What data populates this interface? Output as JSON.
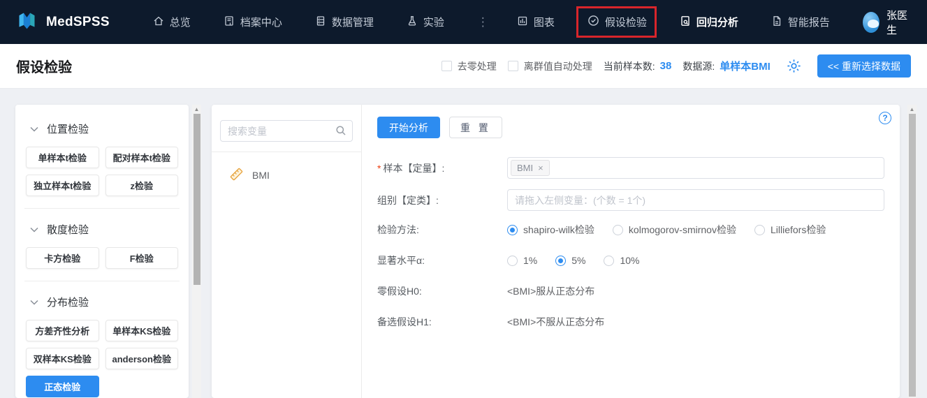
{
  "colors": {
    "nav_bg": "#0d1a2c",
    "accent_blue": "#2d8cf0",
    "annotation_red": "#d8252b",
    "variable_icon_orange": "#e6a23c",
    "page_bg": "#eef0f4"
  },
  "nav": {
    "brand": "MedSPSS",
    "items": [
      {
        "label": "总览",
        "icon": "home-icon"
      },
      {
        "label": "档案中心",
        "icon": "archive-icon"
      },
      {
        "label": "数据管理",
        "icon": "database-icon"
      },
      {
        "label": "实验",
        "icon": "flask-icon"
      },
      {
        "label": "图表",
        "icon": "chart-icon"
      },
      {
        "label": "假设检验",
        "icon": "check-circle-icon",
        "annotated": true
      },
      {
        "label": "回归分析",
        "icon": "doc-search-icon",
        "emphasized": true
      },
      {
        "label": "智能报告",
        "icon": "report-icon"
      }
    ],
    "more_dots": "⋮",
    "user_name": "张医生"
  },
  "header": {
    "title": "假设检验",
    "zero_checkbox_label": "去零处理",
    "outlier_checkbox_label": "离群值自动处理",
    "sample_count_label": "当前样本数:",
    "sample_count": "38",
    "datasource_label": "数据源:",
    "datasource_value": "单样本BMI",
    "reselect_button": "<< 重新选择数据"
  },
  "sidebar": {
    "sections": [
      {
        "title": "位置检验",
        "items": [
          "单样本t检验",
          "配对样本t检验",
          "独立样本t检验",
          "z检验"
        ]
      },
      {
        "title": "散度检验",
        "items": [
          "卡方检验",
          "F检验"
        ]
      },
      {
        "title": "分布检验",
        "items": [
          "方差齐性分析",
          "单样本KS检验",
          "双样本KS检验",
          "anderson检验",
          "正态检验"
        ],
        "active_item": "正态检验"
      }
    ],
    "scroll_up_arrow": "▲"
  },
  "variables": {
    "search_placeholder": "搜索变量",
    "items": [
      {
        "name": "BMI",
        "icon": "ruler-icon"
      }
    ]
  },
  "form": {
    "start_button": "开始分析",
    "reset_button": "重 置",
    "help_glyph": "?",
    "required_mark": "*",
    "sample_label": "样本【定量】:",
    "sample_tag": "BMI",
    "tag_remove_glyph": "×",
    "group_label": "组别【定类】:",
    "group_placeholder": "请拖入左侧变量：(个数 = 1个)",
    "method_label": "检验方法:",
    "methods": [
      {
        "label": "shapiro-wilk检验",
        "selected": true
      },
      {
        "label": "kolmogorov-smirnov检验",
        "selected": false
      },
      {
        "label": "Lilliefors检验",
        "selected": false
      }
    ],
    "alpha_label": "显著水平α:",
    "alphas": [
      {
        "label": "1%",
        "selected": false
      },
      {
        "label": "5%",
        "selected": true
      },
      {
        "label": "10%",
        "selected": false
      }
    ],
    "h0_label": "零假设H0:",
    "h0_value": "<BMI>服从正态分布",
    "h1_label": "备选假设H1:",
    "h1_value": "<BMI>不服从正态分布"
  }
}
